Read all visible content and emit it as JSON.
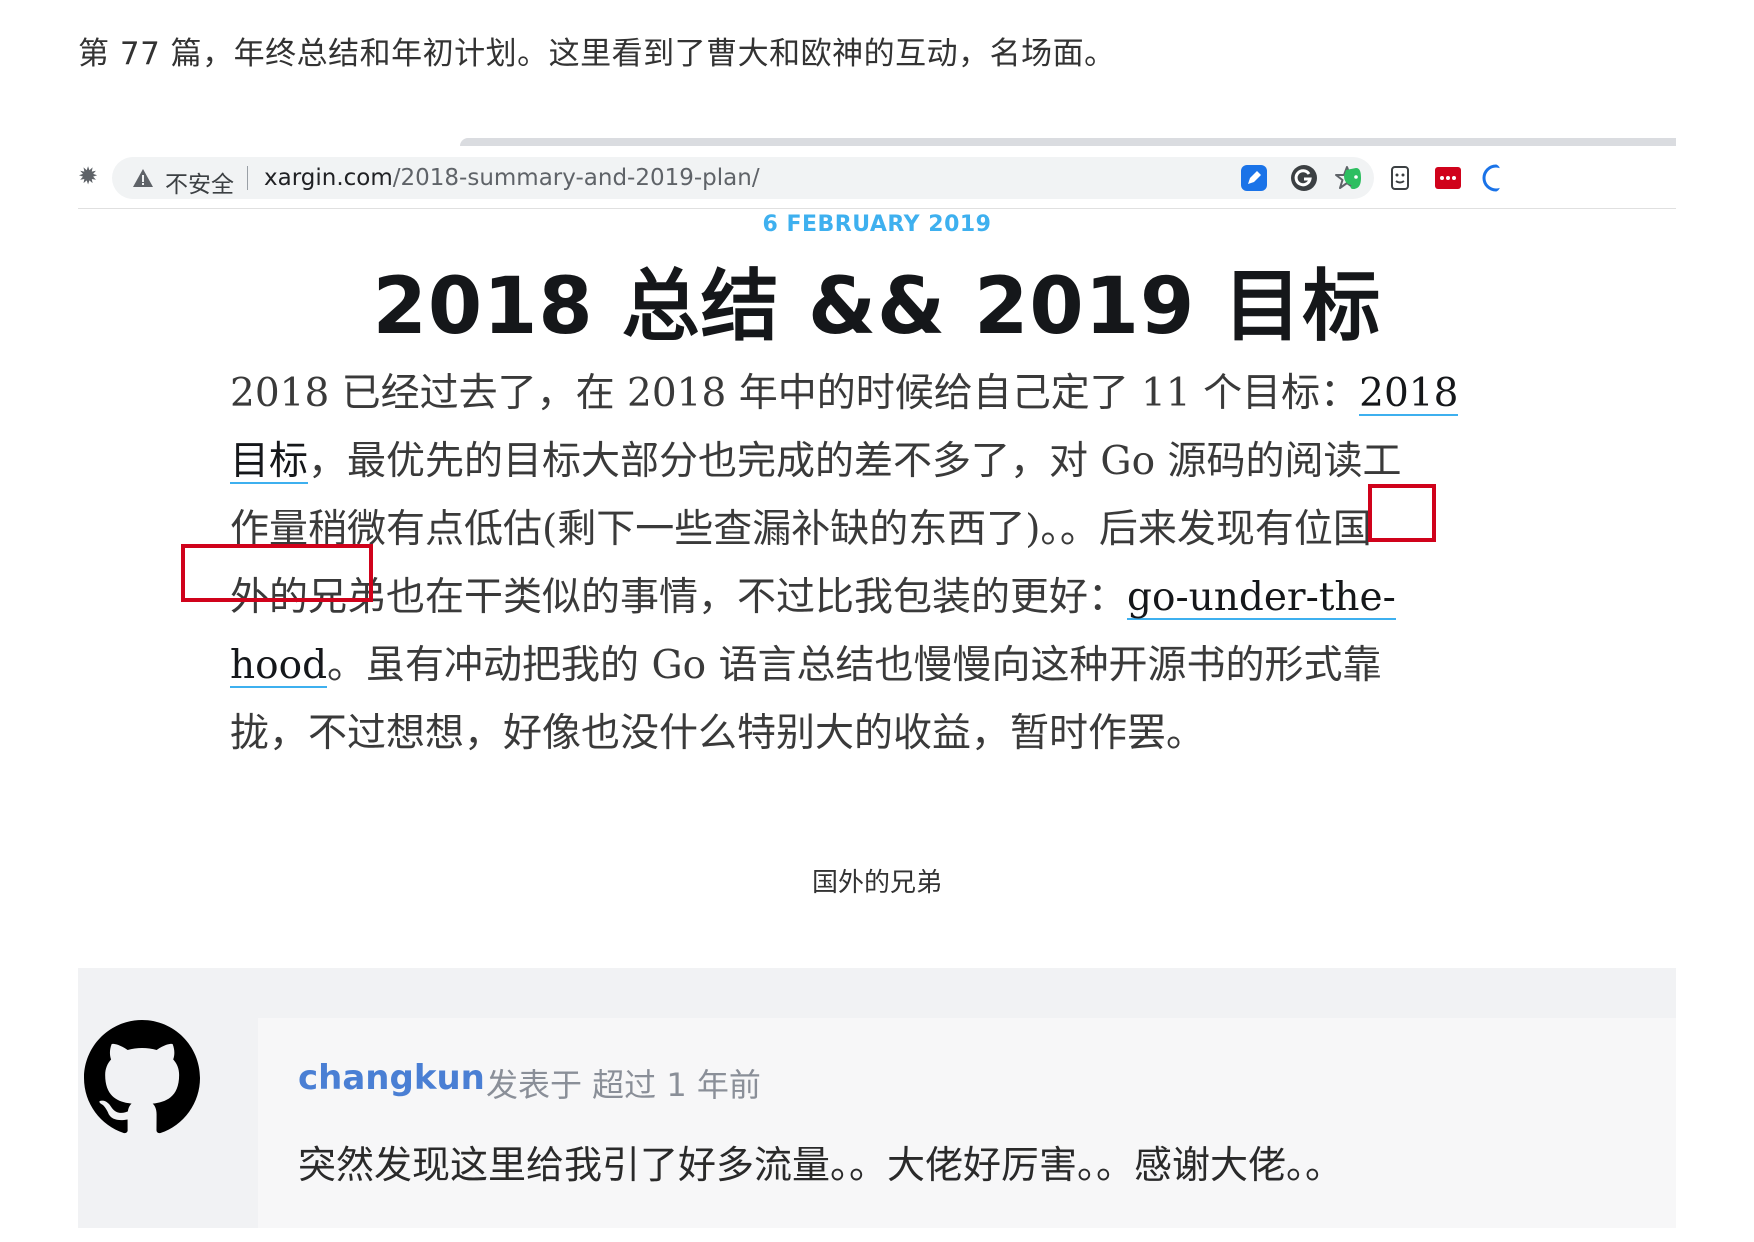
{
  "intro_text": "第 77 篇，年终总结和年初计划。这里看到了曹大和欧神的互动，名场面。",
  "browser": {
    "left_glyph": "✹",
    "security_label": "不安全",
    "url_host": "xargin.com",
    "url_path": "/2018-summary-and-2019-plan/",
    "extension_icons": [
      "pen-extension-icon",
      "grammarly-icon",
      "evernote-icon",
      "face-extension-icon",
      "password-extension-icon",
      "chrome-extension-icon"
    ]
  },
  "article": {
    "date": "6 FEBRUARY 2019",
    "title": "2018 总结 && 2019 目标",
    "paragraph_lines": [
      {
        "a": "2018 已经过去了，在 2018 年中的时候给自己定了 11 个目标：",
        "link": "2018"
      },
      {
        "link": "目标",
        "b": "，最优先的目标大部分也完成的差不多了，对 Go 源码的阅读工"
      },
      {
        "a": "作量稍微有点低估(剩下一些查漏补缺的东西了)。。后来发现有位国"
      },
      {
        "a": "外的兄弟也在干类似的事情，不过比我包装的更好：",
        "link": "go-under-the-"
      },
      {
        "link": "hood",
        "b": "。虽有冲动把我的 Go 语言总结也慢慢向这种开源书的形式靠"
      },
      {
        "a": "拢，不过想想，好像也没什么特别大的收益，暂时作罢。"
      }
    ],
    "caption": "国外的兄弟"
  },
  "comment": {
    "author": "changkun",
    "meta": "发表于  超过 1 年前",
    "body": "突然发现这里给我引了好多流量。。大佬好厉害。。感谢大佬。。"
  },
  "colors": {
    "accent": "#3eb0ef",
    "highlight_box": "#d0021b",
    "author": "#4a7fd4"
  }
}
